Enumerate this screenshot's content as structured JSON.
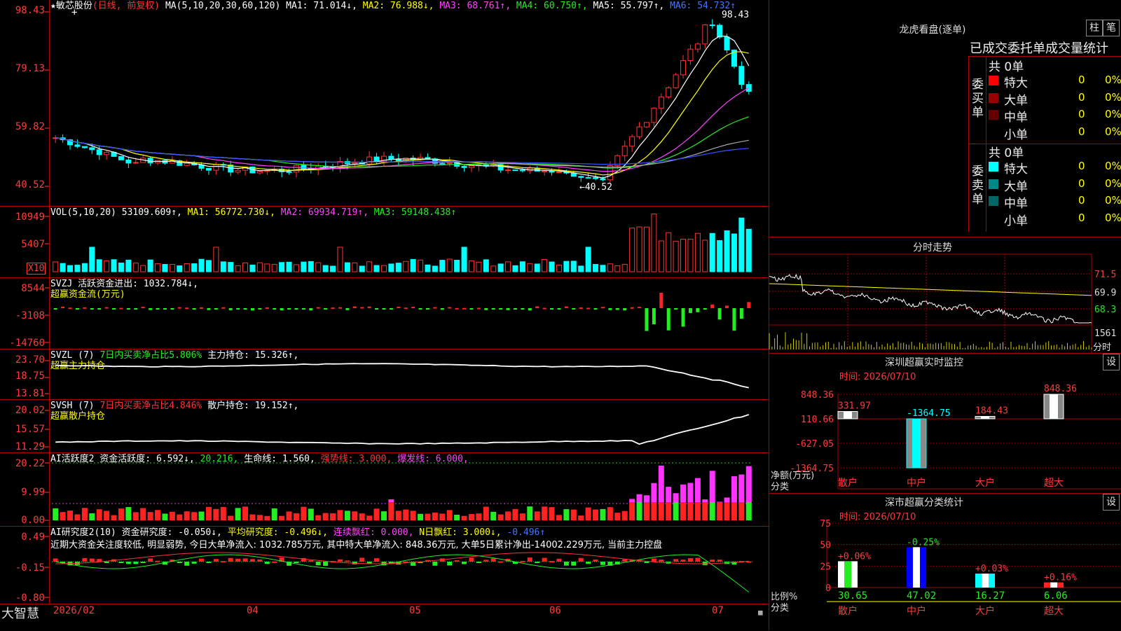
{
  "stock_header": {
    "name": "★敏芯股份",
    "period": "(日线, 前复权)",
    "ma_label": "MA(5,10,20,30,60,120)",
    "ma1": "MA1: 71.014↓,",
    "ma2": "MA2: 76.988↓,",
    "ma3": "MA3: 68.761↑,",
    "ma4": "MA4: 60.750↑,",
    "ma5": "MA5: 55.797↑,",
    "ma6": "MA6: 54.732↑",
    "high_mark": "98.43",
    "low_mark": "←40.52",
    "y_ticks": [
      "98.43",
      "79.13",
      "59.82",
      "40.52"
    ]
  },
  "vol_panel": {
    "label": "VOL(5,10,20)",
    "value": "53109.609↑,",
    "ma1": "MA1: 56772.730↓,",
    "ma2": "MA2: 69934.719↑,",
    "ma3": "MA3: 59148.438↑",
    "unit": "X10",
    "y_ticks": [
      "10949",
      "5407"
    ]
  },
  "svzj_panel": {
    "label": "SVZJ  活跃资金进出: 1032.784↓,",
    "sub": "超赢资金流(万元)",
    "y_ticks": [
      "8544",
      "-3108",
      "-14760"
    ]
  },
  "svzl_panel": {
    "label": "SVZL (7)",
    "desc": "7日内买卖净占比5.806%",
    "value": "主力持仓: 15.326↑,",
    "sub": "超赢主力持仓",
    "y_ticks": [
      "23.70",
      "18.75",
      "13.81"
    ]
  },
  "svsh_panel": {
    "label": "SVSH (7)",
    "desc": "7日内买卖净占比4.846%",
    "value": "散户持仓: 19.152↑,",
    "sub": "超赢散户持仓",
    "y_ticks": [
      "20.02",
      "15.57",
      "11.29"
    ]
  },
  "ai_active_panel": {
    "label": "AI活跃度2 资金活跃度: 6.592↓,",
    "v2": "20.216,",
    "v3": "生命线: 1.560,",
    "v4": "强势线: 3.000,",
    "v5": "爆发线: 6.000,",
    "y_ticks": [
      "20.22",
      "9.99",
      "0.00"
    ]
  },
  "ai_research_panel": {
    "label": "AI研究度2(10) 资金研究度: -0.050↓,",
    "avg": "平均研究度: -0.496↓,",
    "streak": "连续飘红: 0.000,",
    "nday": "N日飘红: 3.000↓,",
    "last": "-0.496↑",
    "comment": "近期大资金关注度较低, 明显弱势, 今日大单净流入: 1032.785万元, 其中特大单净流入: 848.36万元, 大单5日累计净出-14002.229万元, 当前主力控盘",
    "y_ticks": [
      "0.49",
      "-0.15",
      "-0.80"
    ]
  },
  "x_axis": {
    "brand": "大智慧",
    "labels": [
      "2026/02",
      "04",
      "05",
      "06",
      "07"
    ]
  },
  "longhu": {
    "title": "龙虎看盘(逐单)",
    "btn1": "柱",
    "btn2": "笔",
    "head": "已成交委托单成交量统计",
    "buy_label": "委买单",
    "sell_label": "委卖单",
    "buy_total": "共 0单",
    "sell_total": "共 0单",
    "buy_rows": [
      {
        "name": "特大",
        "n1": "0",
        "n2": "0%",
        "color": "#ff0000"
      },
      {
        "name": "大单",
        "n1": "0",
        "n2": "0%",
        "color": "#990000"
      },
      {
        "name": "中单",
        "n1": "0",
        "n2": "0%",
        "color": "#660000"
      },
      {
        "name": "小单",
        "n1": "0",
        "n2": "0%",
        "color": "#000000"
      }
    ],
    "sell_rows": [
      {
        "name": "特大",
        "n1": "0",
        "n2": "0%",
        "color": "#00ffff"
      },
      {
        "name": "大单",
        "n1": "0",
        "n2": "0%",
        "color": "#008888"
      },
      {
        "name": "中单",
        "n1": "0",
        "n2": "0%",
        "color": "#006666"
      },
      {
        "name": "小单",
        "n1": "0",
        "n2": "0%",
        "color": "#000000"
      }
    ]
  },
  "intraday": {
    "title": "分时走势",
    "price_labels": [
      "71.5",
      "69.9",
      "68.3"
    ],
    "vol_label": "1561",
    "unit": "分时"
  },
  "shenzhen_monitor": {
    "title": "深圳超赢实时监控",
    "btn": "设",
    "time": "时间: 2026/07/10",
    "y_ticks": [
      "848.36",
      "110.66",
      "-627.05",
      "-1364.75"
    ],
    "ylabel": "净额(万元)",
    "xlabel": "分类",
    "categories": [
      "散户",
      "中户",
      "大户",
      "超大"
    ],
    "values": [
      331.97,
      -1364.75,
      184.43,
      848.36
    ],
    "value_labels": [
      "331.97",
      "-1364.75",
      "184.43",
      "848.36"
    ]
  },
  "shenzhen_class": {
    "title": "深市超赢分类统计",
    "btn": "设",
    "time": "时间: 2026/07/10",
    "y_ticks": [
      "75",
      "50",
      "25",
      "0"
    ],
    "ylabel": "比例%",
    "xlabel": "分类",
    "categories": [
      "散户",
      "中户",
      "大户",
      "超大"
    ],
    "values": [
      30.65,
      47.02,
      16.27,
      6.06
    ],
    "changes": [
      "+0.06%",
      "-0.25%",
      "+0.03%",
      "+0.16%"
    ],
    "value_labels": [
      "30.65",
      "47.02",
      "16.27",
      "6.06"
    ]
  },
  "chart_data": [
    {
      "type": "bar",
      "title": "深圳超赢实时监控",
      "ylabel": "净额(万元)",
      "xlabel": "分类",
      "categories": [
        "散户",
        "中户",
        "大户",
        "超大"
      ],
      "values": [
        331.97,
        -1364.75,
        184.43,
        848.36
      ],
      "ylim": [
        -1364.75,
        848.36
      ]
    },
    {
      "type": "bar",
      "title": "深市超赢分类统计",
      "ylabel": "比例%",
      "xlabel": "分类",
      "categories": [
        "散户",
        "中户",
        "大户",
        "超大"
      ],
      "values": [
        30.65,
        47.02,
        16.27,
        6.06
      ],
      "ylim": [
        0,
        75
      ]
    }
  ]
}
